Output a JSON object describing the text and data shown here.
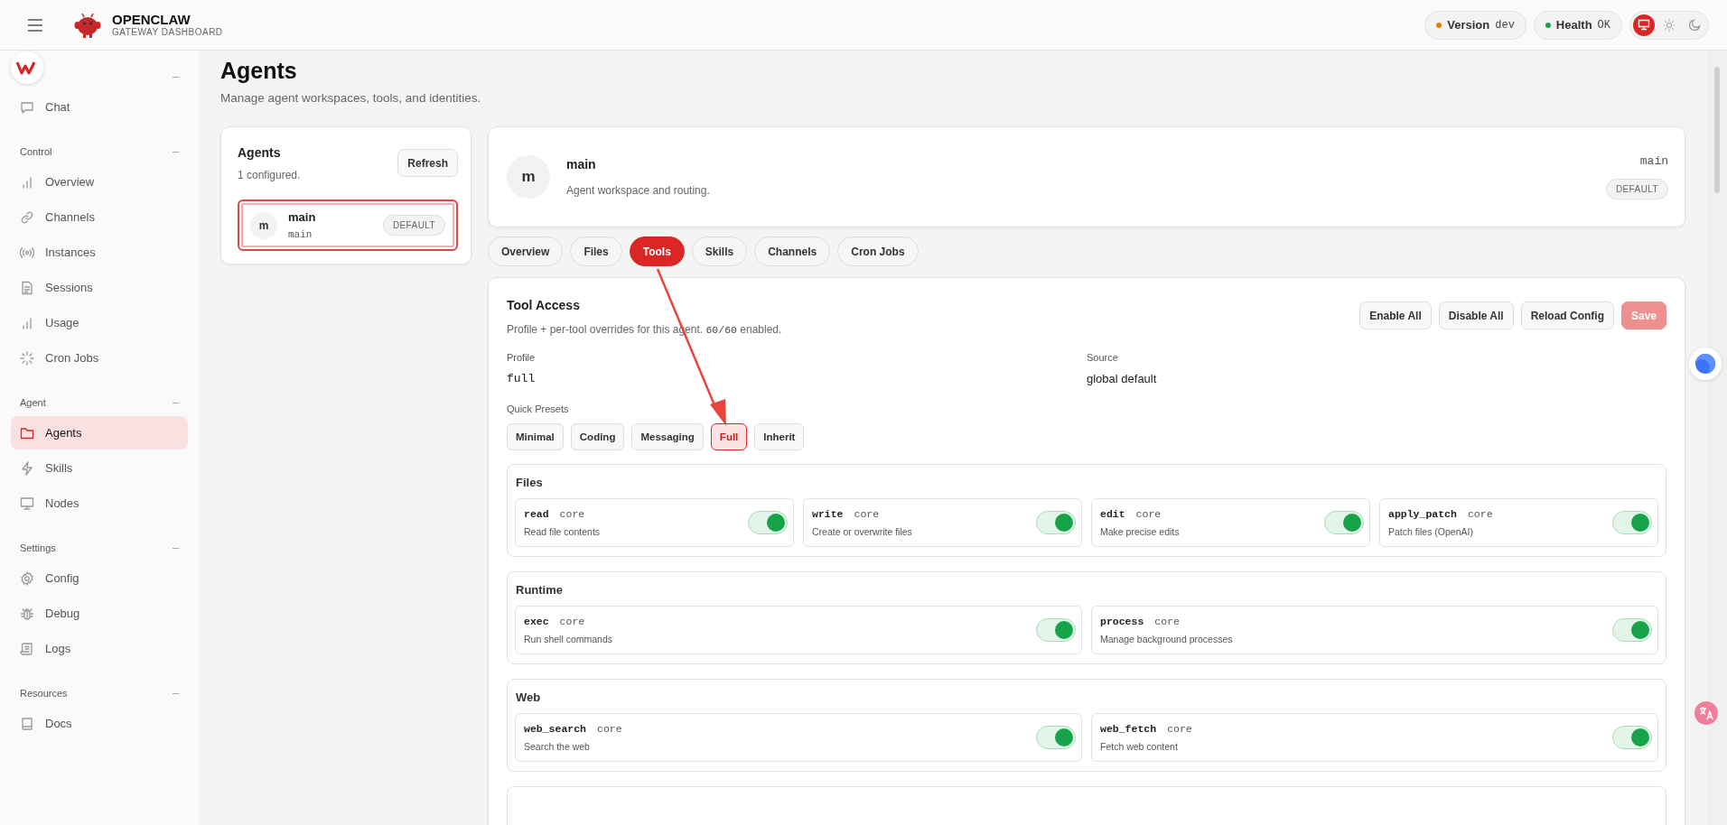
{
  "brand": {
    "name": "OPENCLAW",
    "subtitle": "GATEWAY DASHBOARD"
  },
  "status": [
    {
      "label": "Version",
      "value": "dev",
      "color": "#e67e00"
    },
    {
      "label": "Health",
      "value": "OK",
      "color": "#16a34a"
    }
  ],
  "theme_modes": [
    {
      "kind": "system",
      "selected": true
    },
    {
      "kind": "light",
      "selected": false
    },
    {
      "kind": "dark",
      "selected": false
    }
  ],
  "sidebar": {
    "sections": [
      {
        "items": [
          {
            "label": "Chat",
            "kind": "chat",
            "selected": false
          }
        ]
      },
      {
        "title": "Control",
        "items": [
          {
            "label": "Overview",
            "kind": "bars",
            "selected": false
          },
          {
            "label": "Channels",
            "kind": "link",
            "selected": false
          },
          {
            "label": "Instances",
            "kind": "radio",
            "selected": false
          },
          {
            "label": "Sessions",
            "kind": "doc",
            "selected": false
          },
          {
            "label": "Usage",
            "kind": "bars",
            "selected": false
          },
          {
            "label": "Cron Jobs",
            "kind": "loader",
            "selected": false
          }
        ]
      },
      {
        "title": "Agent",
        "items": [
          {
            "label": "Agents",
            "kind": "folder",
            "selected": true
          },
          {
            "label": "Skills",
            "kind": "bolt",
            "selected": false
          },
          {
            "label": "Nodes",
            "kind": "monitor",
            "selected": false
          }
        ]
      },
      {
        "title": "Settings",
        "items": [
          {
            "label": "Config",
            "kind": "gear",
            "selected": false
          },
          {
            "label": "Debug",
            "kind": "bug",
            "selected": false
          },
          {
            "label": "Logs",
            "kind": "scroll",
            "selected": false
          }
        ]
      },
      {
        "title": "Resources",
        "items": [
          {
            "label": "Docs",
            "kind": "book",
            "selected": false
          }
        ]
      }
    ]
  },
  "page": {
    "title": "Agents",
    "subtitle": "Manage agent workspaces, tools, and identities."
  },
  "agents_panel": {
    "title": "Agents",
    "count": "1 configured.",
    "refresh": "Refresh",
    "agents": [
      {
        "avatar": "m",
        "name": "main",
        "id": "main",
        "badge": "DEFAULT",
        "selected": true
      }
    ]
  },
  "agent_header": {
    "avatar": "m",
    "name": "main",
    "description": "Agent workspace and routing.",
    "id": "main",
    "badge": "DEFAULT"
  },
  "tabs": [
    {
      "label": "Overview",
      "selected": false
    },
    {
      "label": "Files",
      "selected": false
    },
    {
      "label": "Tools",
      "selected": true
    },
    {
      "label": "Skills",
      "selected": false
    },
    {
      "label": "Channels",
      "selected": false
    },
    {
      "label": "Cron Jobs",
      "selected": false
    }
  ],
  "tool_access": {
    "title": "Tool Access",
    "description_before": "Profile + per-tool overrides for this agent.",
    "enabled_count": "60/60",
    "description_after": "enabled.",
    "actions": [
      {
        "label": "Enable All",
        "kind": "secondary"
      },
      {
        "label": "Disable All",
        "kind": "secondary"
      },
      {
        "label": "Reload Config",
        "kind": "secondary"
      },
      {
        "label": "Save",
        "kind": "primary-disabled"
      }
    ],
    "profile": {
      "label": "Profile",
      "value": "full"
    },
    "source": {
      "label": "Source",
      "value": "global default"
    },
    "presets_label": "Quick Presets",
    "presets": [
      {
        "label": "Minimal",
        "selected": false
      },
      {
        "label": "Coding",
        "selected": false
      },
      {
        "label": "Messaging",
        "selected": false
      },
      {
        "label": "Full",
        "selected": true
      },
      {
        "label": "Inherit",
        "selected": false
      }
    ],
    "groups": [
      {
        "title": "Files",
        "tools": [
          {
            "name": "read",
            "tag": "core",
            "description": "Read file contents",
            "on": true
          },
          {
            "name": "write",
            "tag": "core",
            "description": "Create or overwrite files",
            "on": true
          },
          {
            "name": "edit",
            "tag": "core",
            "description": "Make precise edits",
            "on": true
          },
          {
            "name": "apply_patch",
            "tag": "core",
            "description": "Patch files (OpenAI)",
            "on": true
          }
        ]
      },
      {
        "title": "Runtime",
        "tools": [
          {
            "name": "exec",
            "tag": "core",
            "description": "Run shell commands",
            "on": true
          },
          {
            "name": "process",
            "tag": "core",
            "description": "Manage background processes",
            "on": true
          }
        ]
      },
      {
        "title": "Web",
        "tools": [
          {
            "name": "web_search",
            "tag": "core",
            "description": "Search the web",
            "on": true
          },
          {
            "name": "web_fetch",
            "tag": "core",
            "description": "Fetch web content",
            "on": true
          }
        ]
      }
    ]
  }
}
